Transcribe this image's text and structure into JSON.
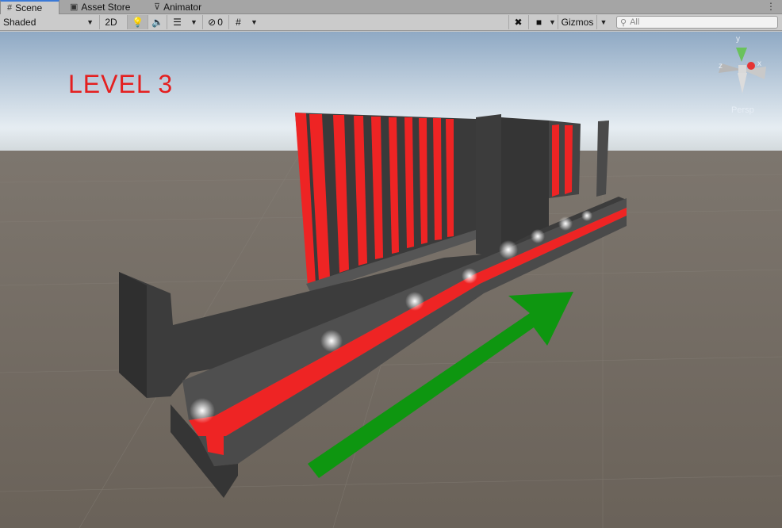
{
  "tabs": [
    {
      "label": "Scene",
      "icon": "grid-icon",
      "active": true
    },
    {
      "label": "Asset Store",
      "icon": "store-bag-icon",
      "active": false
    },
    {
      "label": "Animator",
      "icon": "animator-icon",
      "active": false
    }
  ],
  "toolbar": {
    "draw_mode": "Shaded",
    "mode_2d": "2D",
    "hidden_count": "0",
    "gizmos_label": "Gizmos",
    "search_placeholder": "All"
  },
  "scene": {
    "annotation_text": "LEVEL 3",
    "projection_label": "Persp",
    "axes": {
      "x": "x",
      "y": "y",
      "z": "z"
    },
    "colors": {
      "sky_top": "#8fa9c4",
      "sky_horizon": "#e6edf2",
      "ground": "#6f675e",
      "wall_red": "#ee2424",
      "wall_dark": "#3b3b3b",
      "arrow_green": "#0e9610"
    }
  }
}
